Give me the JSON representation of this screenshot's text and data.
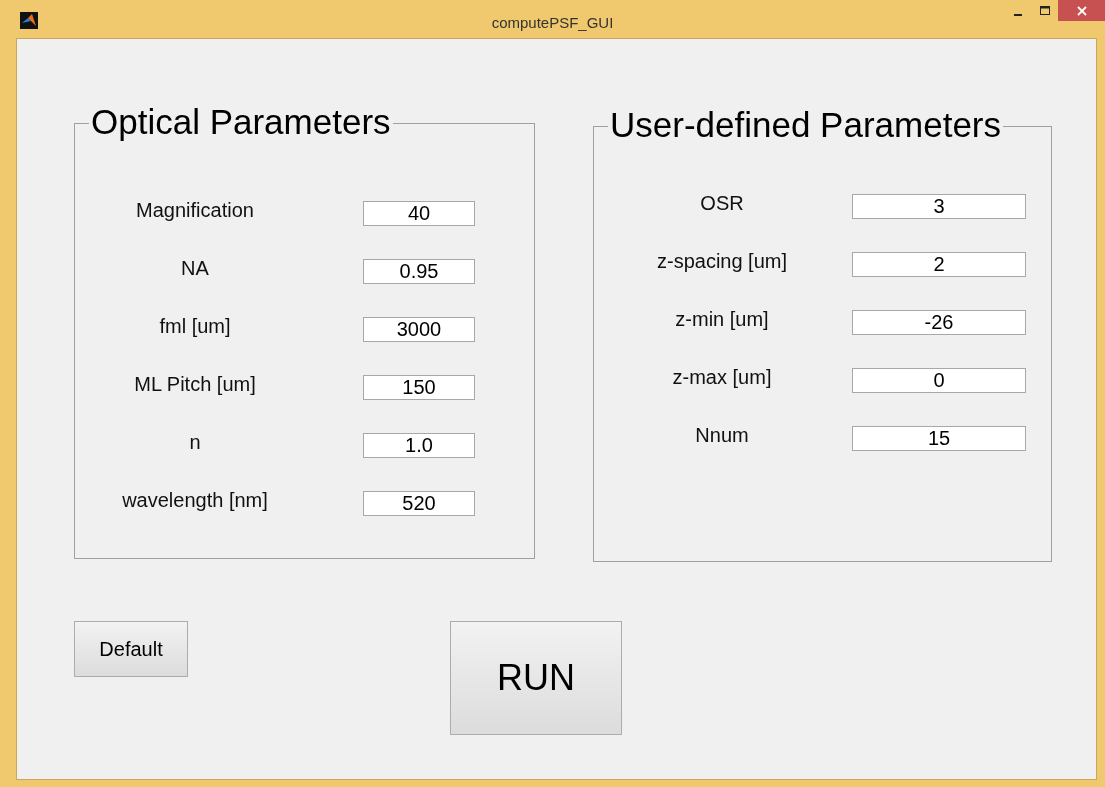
{
  "window": {
    "title": "computePSF_GUI"
  },
  "panels": [
    {
      "title": "Optical Parameters",
      "kind": "narrow",
      "fields": [
        {
          "label": "Magnification",
          "value": "40"
        },
        {
          "label": "NA",
          "value": "0.95"
        },
        {
          "label": "fml [um]",
          "value": "3000"
        },
        {
          "label": "ML Pitch [um]",
          "value": "150"
        },
        {
          "label": "n",
          "value": "1.0"
        },
        {
          "label": "wavelength [nm]",
          "value": "520"
        }
      ]
    },
    {
      "title": "User-defined Parameters",
      "kind": "wide",
      "fields": [
        {
          "label": "OSR",
          "value": "3"
        },
        {
          "label": "z-spacing [um]",
          "value": "2"
        },
        {
          "label": "z-min [um]",
          "value": "-26"
        },
        {
          "label": "z-max [um]",
          "value": "0"
        },
        {
          "label": "Nnum",
          "value": "15"
        }
      ]
    }
  ],
  "buttons": [
    {
      "label": "Default",
      "kind": "small"
    },
    {
      "label": "RUN",
      "kind": "large"
    }
  ]
}
